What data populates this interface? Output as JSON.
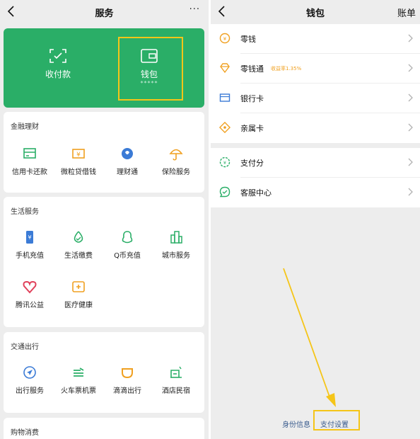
{
  "left": {
    "nav": {
      "title": "服务",
      "more": "···"
    },
    "top_card": {
      "pay": {
        "label": "收付款"
      },
      "wallet": {
        "label": "钱包",
        "masked": "*****"
      }
    },
    "sections": [
      {
        "title": "金融理财",
        "items": [
          {
            "label": "信用卡还款",
            "icon": "credit-card-icon"
          },
          {
            "label": "微粒贷借钱",
            "icon": "loan-icon"
          },
          {
            "label": "理财通",
            "icon": "wealth-icon"
          },
          {
            "label": "保险服务",
            "icon": "umbrella-icon"
          }
        ]
      },
      {
        "title": "生活服务",
        "items": [
          {
            "label": "手机充值",
            "icon": "phone-topup-icon"
          },
          {
            "label": "生活缴费",
            "icon": "utility-icon"
          },
          {
            "label": "Q币充值",
            "icon": "qq-icon"
          },
          {
            "label": "城市服务",
            "icon": "city-icon"
          },
          {
            "label": "腾讯公益",
            "icon": "charity-icon"
          },
          {
            "label": "医疗健康",
            "icon": "medical-icon"
          }
        ]
      },
      {
        "title": "交通出行",
        "items": [
          {
            "label": "出行服务",
            "icon": "navigation-icon"
          },
          {
            "label": "火车票机票",
            "icon": "train-icon"
          },
          {
            "label": "滴滴出行",
            "icon": "didi-icon"
          },
          {
            "label": "酒店民宿",
            "icon": "hotel-icon"
          }
        ]
      },
      {
        "title": "购物消费",
        "items": []
      }
    ]
  },
  "right": {
    "nav": {
      "title": "钱包",
      "right_text": "账单"
    },
    "group1": [
      {
        "label": "零钱",
        "icon": "coin-icon"
      },
      {
        "label": "零钱通",
        "sub": "收益率1.35%",
        "icon": "diamond-icon"
      },
      {
        "label": "银行卡",
        "icon": "bank-card-icon"
      },
      {
        "label": "亲属卡",
        "icon": "family-card-icon"
      }
    ],
    "group2": [
      {
        "label": "支付分",
        "icon": "pay-score-icon"
      },
      {
        "label": "客服中心",
        "icon": "customer-service-icon"
      }
    ],
    "footer": {
      "identity": "身份信息",
      "pay_settings": "支付设置"
    }
  },
  "colors": {
    "green": "#2aae67",
    "highlight": "#f5c518",
    "icon_green": "#2aae67",
    "icon_orange": "#f0a020",
    "icon_blue": "#3b7bd6"
  }
}
